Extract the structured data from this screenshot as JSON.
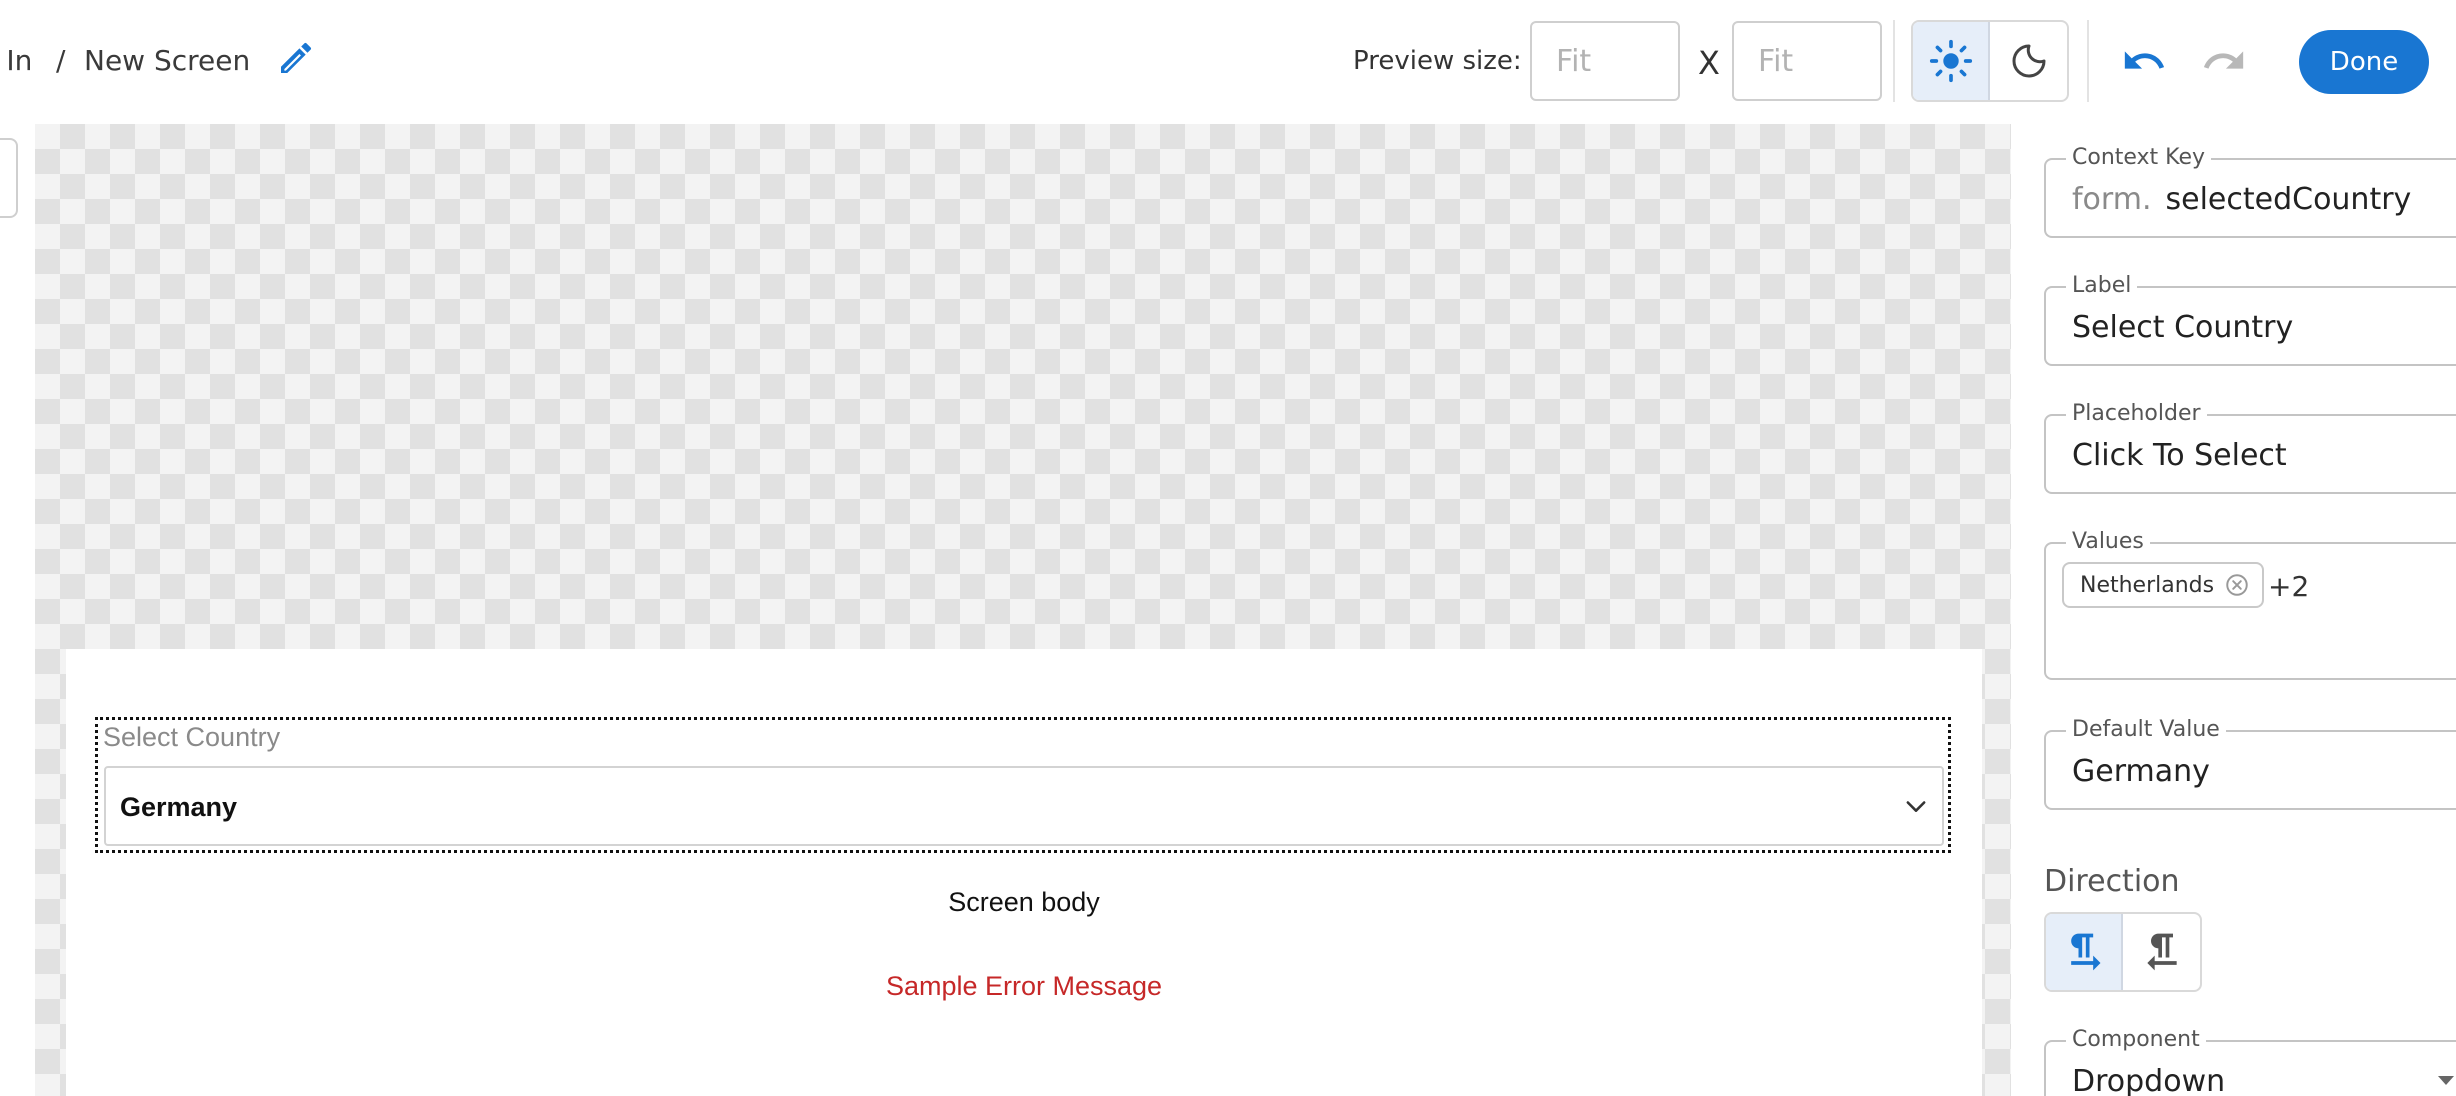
{
  "breadcrumb": {
    "parent": "r In",
    "separator": "/",
    "current": "New Screen"
  },
  "toolbar": {
    "preview_label": "Preview size:",
    "width_placeholder": "Fit",
    "height_placeholder": "Fit",
    "size_separator": "X",
    "done_label": "Done"
  },
  "canvas": {
    "field_label": "Select Country",
    "field_value": "Germany",
    "body_text": "Screen body",
    "error_text": "Sample Error Message"
  },
  "panel": {
    "context_key": {
      "legend": "Context Key",
      "prefix": "form.",
      "value": "selectedCountry"
    },
    "label": {
      "legend": "Label",
      "value": "Select Country"
    },
    "placeholder": {
      "legend": "Placeholder",
      "value": "Click To Select"
    },
    "values": {
      "legend": "Values",
      "chips": [
        "Netherlands"
      ],
      "more": "+2"
    },
    "default_value": {
      "legend": "Default Value",
      "value": "Germany"
    },
    "direction_title": "Direction",
    "component": {
      "legend": "Component",
      "value": "Dropdown"
    }
  },
  "colors": {
    "accent": "#1976d2",
    "error": "#c62828"
  },
  "icons": [
    "pencil-icon",
    "sun-icon",
    "moon-icon",
    "undo-icon",
    "redo-icon",
    "chevron-down-icon",
    "clear-chip-icon",
    "ltr-icon",
    "rtl-icon"
  ]
}
